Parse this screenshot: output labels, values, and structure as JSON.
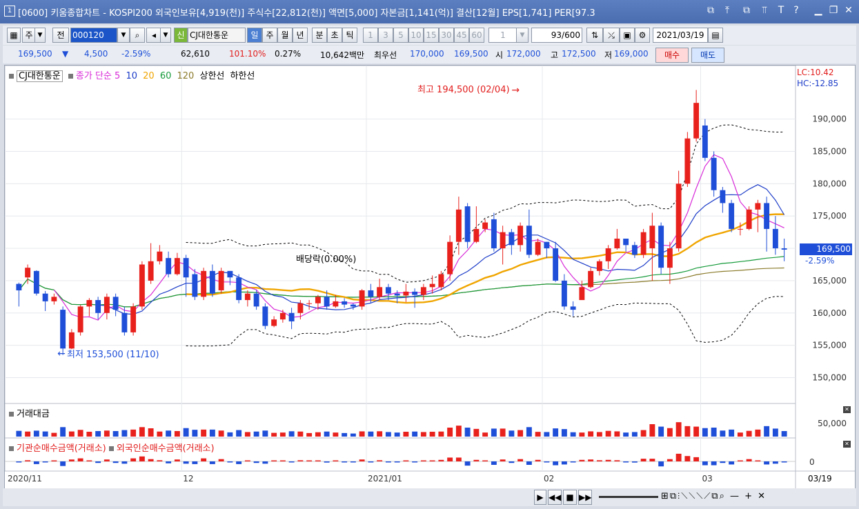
{
  "window": {
    "icon_label": "1",
    "title": "[0600] 키움종합차트 - KOSPI200 외국인보유[4,919(천)] 주식수[22,812(천)] 액면[5,000] 자본금[1,141(억)] 결산[12월] EPS[1,741] PER[97.3"
  },
  "toolbar": {
    "market": "주",
    "prev_label": "전",
    "code": "000120",
    "credit_badge": "신",
    "stock_name": "CJ대한통운",
    "periods": [
      "일",
      "주",
      "월",
      "년",
      "분",
      "초",
      "틱"
    ],
    "minutes": [
      "1",
      "3",
      "5",
      "10",
      "15",
      "30",
      "45",
      "60"
    ],
    "unit_value": "1",
    "count": "93/600",
    "date": "2021/03/19"
  },
  "quote": {
    "price": "169,500",
    "direction": "▼",
    "change": "4,500",
    "change_pct": "-2.59%",
    "volume": "62,610",
    "vol_ratio": "101.10%",
    "turnover": "0.27%",
    "amount": "10,642백만",
    "best_ask_label": "최우선",
    "best_ask": "170,000",
    "best_bid": "169,500",
    "open_label": "시",
    "open": "172,000",
    "high_label": "고",
    "high": "172,500",
    "low_label": "저",
    "low": "169,000",
    "buy_label": "매수",
    "sell_label": "매도"
  },
  "chart_data": [
    {
      "type": "candlestick",
      "name": "CJ대한통운",
      "legend": {
        "price": "종가 단순",
        "ma": [
          "5",
          "10",
          "20",
          "60",
          "120"
        ],
        "upper": "상한선",
        "lower": "하한선"
      },
      "ma_colors": {
        "5": "#d82ad8",
        "10": "#1c3cc8",
        "20": "#f0a500",
        "60": "#159a3a",
        "120": "#8a7a2a"
      },
      "x_labels": [
        "2020/11",
        "12",
        "2021/01",
        "02",
        "03"
      ],
      "y_ticks": [
        150000,
        155000,
        160000,
        165000,
        170000,
        175000,
        180000,
        185000,
        190000
      ],
      "y_range": [
        146000,
        197000
      ],
      "indicators": {
        "lc": "LC:10.42",
        "hc": "HC:-12.85"
      },
      "current_label": "169,500",
      "current_pct": "-2.59%",
      "annotations": {
        "high": "최고 194,500 (02/04)",
        "low": "최저 153,500 (11/10)",
        "dividend": "배당락(0.00%)"
      },
      "candles": [
        [
          164500,
          163500,
          161000,
          164700
        ],
        [
          165500,
          167000,
          164500,
          167500
        ],
        [
          166500,
          163000,
          162700,
          166600
        ],
        [
          163000,
          161800,
          160300,
          163400
        ],
        [
          161800,
          162500,
          161300,
          163000
        ],
        [
          160500,
          154500,
          153500,
          161000
        ],
        [
          154500,
          157000,
          154400,
          157500
        ],
        [
          157000,
          161000,
          156500,
          161200
        ],
        [
          161000,
          162000,
          159500,
          162300
        ],
        [
          162000,
          160000,
          159000,
          162500
        ],
        [
          160000,
          162500,
          159000,
          163000
        ],
        [
          162500,
          160500,
          159500,
          163000
        ],
        [
          160000,
          157000,
          156500,
          161000
        ],
        [
          157000,
          161000,
          156500,
          161500
        ],
        [
          161000,
          167500,
          160500,
          168000
        ],
        [
          165000,
          168000,
          164500,
          170800
        ],
        [
          168000,
          169500,
          167500,
          170500
        ],
        [
          168500,
          166000,
          165500,
          169500
        ],
        [
          166000,
          168500,
          165800,
          169300
        ],
        [
          168500,
          165500,
          162500,
          169000
        ],
        [
          166000,
          162500,
          162000,
          166800
        ],
        [
          162500,
          166500,
          162000,
          167000
        ],
        [
          166500,
          163000,
          162500,
          167500
        ],
        [
          163500,
          166500,
          163000,
          167000
        ],
        [
          166500,
          165500,
          164300,
          166500
        ],
        [
          165500,
          162000,
          161500,
          166000
        ],
        [
          162000,
          163000,
          161000,
          163500
        ],
        [
          163000,
          161000,
          160500,
          163500
        ],
        [
          161000,
          158000,
          157500,
          161500
        ],
        [
          158000,
          159000,
          157800,
          159500
        ],
        [
          159000,
          160000,
          158500,
          160500
        ],
        [
          160000,
          158700,
          157500,
          160800
        ],
        [
          160000,
          161500,
          159000,
          162000
        ],
        [
          161500,
          161500,
          160500,
          162000
        ],
        [
          161500,
          162500,
          160500,
          162800
        ],
        [
          162500,
          161000,
          160500,
          163500
        ],
        [
          161000,
          161800,
          160800,
          162800
        ],
        [
          161800,
          161300,
          160800,
          162300
        ],
        [
          161300,
          161000,
          160500,
          161500
        ],
        [
          161000,
          163500,
          160500,
          163700
        ],
        [
          163500,
          162500,
          161500,
          164500
        ],
        [
          162500,
          164000,
          162000,
          165300
        ],
        [
          164000,
          163000,
          162000,
          164500
        ],
        [
          163000,
          162700,
          161500,
          163500
        ],
        [
          162700,
          163300,
          161700,
          164500
        ],
        [
          163300,
          162800,
          160800,
          163800
        ],
        [
          162800,
          164000,
          162000,
          164500
        ],
        [
          164000,
          164500,
          163000,
          165800
        ],
        [
          164000,
          166000,
          163500,
          166500
        ],
        [
          166000,
          171000,
          165000,
          172000
        ],
        [
          171000,
          176000,
          169000,
          178000
        ],
        [
          176500,
          171000,
          170000,
          177000
        ],
        [
          171000,
          173000,
          170800,
          176500
        ],
        [
          173000,
          174000,
          172500,
          174500
        ],
        [
          174500,
          170000,
          169500,
          175500
        ],
        [
          170000,
          172500,
          167500,
          173500
        ],
        [
          172500,
          170500,
          169000,
          173000
        ],
        [
          170500,
          173500,
          169500,
          174000
        ],
        [
          173500,
          169000,
          168500,
          176000
        ],
        [
          169000,
          171000,
          168800,
          171500
        ],
        [
          171000,
          170000,
          168500,
          171000
        ],
        [
          170000,
          165000,
          164800,
          171000
        ],
        [
          165000,
          161000,
          160500,
          166000
        ],
        [
          161000,
          160500,
          159500,
          161800
        ],
        [
          162000,
          164000,
          163000,
          165000
        ],
        [
          164000,
          166500,
          163800,
          167000
        ],
        [
          166500,
          168000,
          165800,
          168300
        ],
        [
          168000,
          170000,
          166800,
          170500
        ],
        [
          170000,
          171500,
          169800,
          173000
        ],
        [
          171500,
          170500,
          169500,
          171500
        ],
        [
          170500,
          169000,
          168500,
          171000
        ],
        [
          169000,
          172500,
          168500,
          173000
        ],
        [
          170000,
          173500,
          165000,
          175500
        ],
        [
          173500,
          167000,
          166000,
          174000
        ],
        [
          167000,
          170000,
          164500,
          171000
        ],
        [
          170000,
          180000,
          169500,
          182000
        ],
        [
          180000,
          187000,
          179500,
          188000
        ],
        [
          187000,
          192500,
          186500,
          194500
        ],
        [
          189000,
          184000,
          183500,
          190000
        ],
        [
          184000,
          179000,
          178000,
          185000
        ],
        [
          179000,
          177000,
          175500,
          179500
        ],
        [
          177000,
          173000,
          172500,
          177500
        ],
        [
          173000,
          173000,
          172000,
          174000
        ],
        [
          173000,
          176000,
          172800,
          176500
        ],
        [
          176000,
          177000,
          172500,
          177500
        ],
        [
          177000,
          173000,
          169500,
          178000
        ],
        [
          173000,
          170000,
          169000,
          175000
        ],
        [
          170000,
          169800,
          168000,
          171500
        ]
      ]
    },
    {
      "type": "bar",
      "name": "거래대금",
      "y_ticks": [
        "50,000"
      ]
    },
    {
      "type": "bar",
      "name": "기관순매수금액(거래소) / 외국인순매수금액(거래소)",
      "y_ticks": [
        "0"
      ]
    }
  ],
  "panels": {
    "volume_title": "거래대금",
    "flow_title_1": "기관순매수금액(거래소)",
    "flow_title_2": "외국인순매수금액(거래소)"
  },
  "xaxis": {
    "end_date": "03/19"
  }
}
